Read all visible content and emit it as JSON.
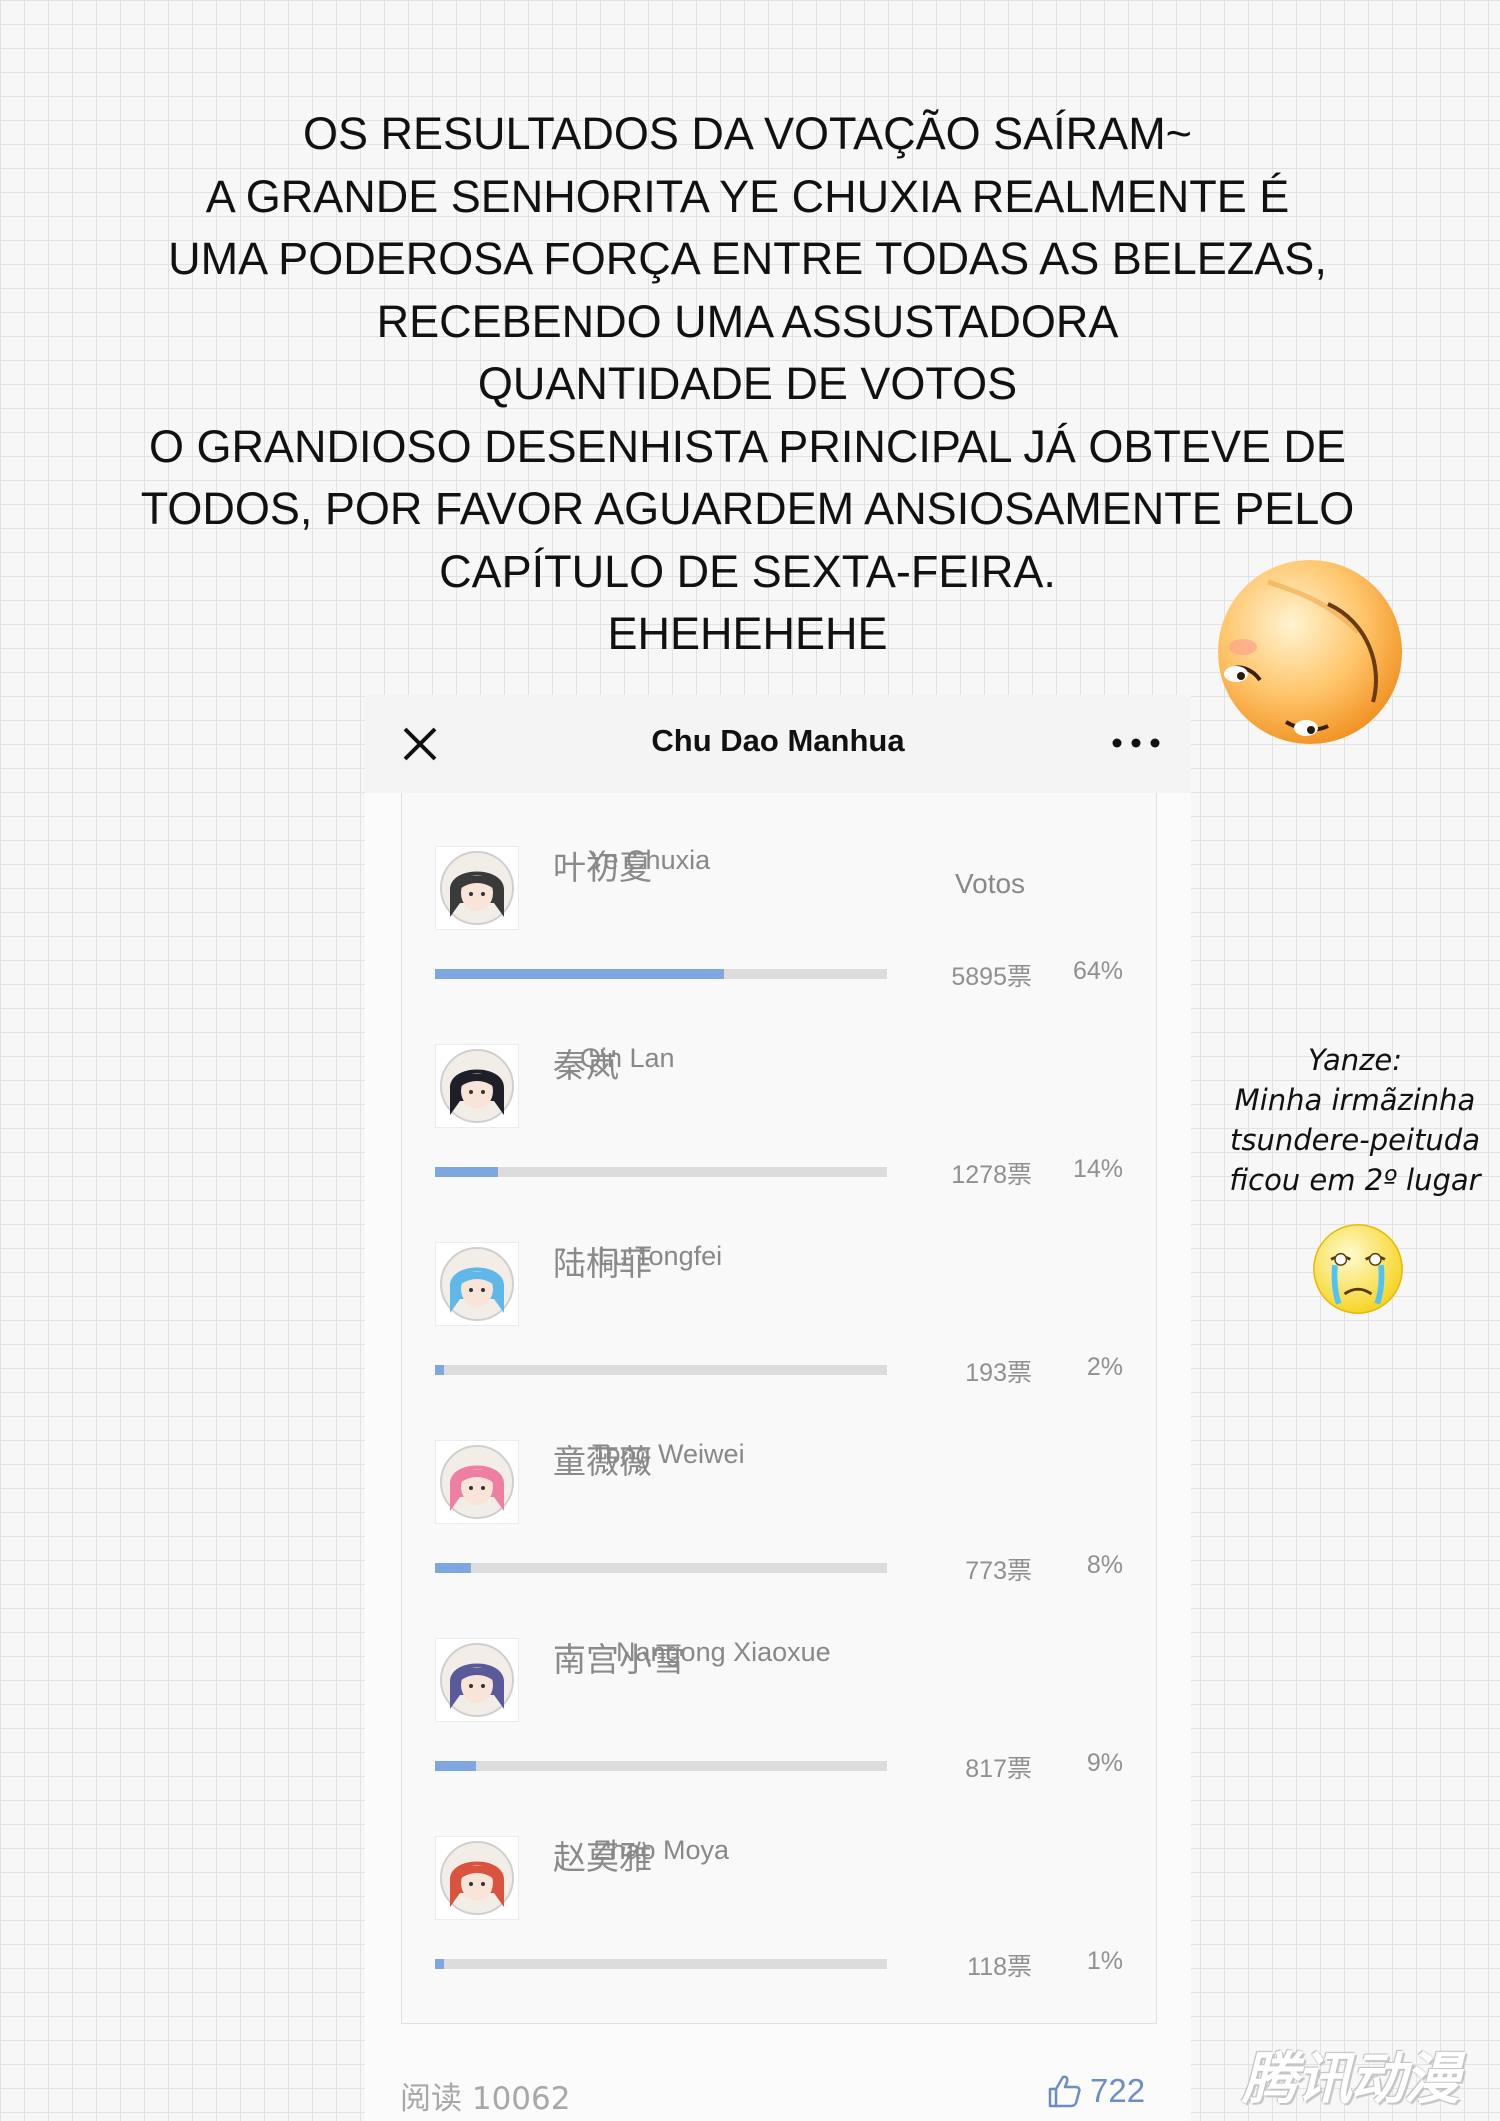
{
  "announcement": {
    "lines": [
      "OS RESULTADOS DA VOTAÇÃO SAÍRAM~",
      "A GRANDE SENHORITA YE CHUXIA REALMENTE É",
      "UMA PODEROSA FORÇA ENTRE TODAS AS BELEZAS,",
      "RECEBENDO UMA ASSUSTADORA",
      "QUANTIDADE DE VOTOS",
      "O GRANDIOSO DESENHISTA PRINCIPAL JÁ OBTEVE DE",
      "TODOS, POR FAVOR AGUARDEM ANSIOSAMENTE PELO",
      "CAPÍTULO DE SEXTA-FEIRA.",
      "EHEHEHEHE"
    ]
  },
  "side_note": {
    "lines": [
      "Yanze:",
      "Minha irmãzinha",
      "tsundere-peituda",
      "ficou em 2º lugar"
    ]
  },
  "header": {
    "title": "Chu Dao Manhua",
    "close_icon": "close-icon",
    "more_icon": "more-dots-icon"
  },
  "poll": {
    "votes_column_label": "Votos",
    "options": [
      {
        "name_cn": "叶初夏",
        "name_en": "Ye Chuxia",
        "votes": "5895票",
        "percent": "64%",
        "fraction": 0.64,
        "hair": "#3a3a3a"
      },
      {
        "name_cn": "秦岚",
        "name_en": "Qin Lan",
        "votes": "1278票",
        "percent": "14%",
        "fraction": 0.14,
        "hair": "#1f1f2a"
      },
      {
        "name_cn": "陆桐菲",
        "name_en": "Lu Tongfei",
        "votes": "193票",
        "percent": "2%",
        "fraction": 0.02,
        "hair": "#5fb8e8"
      },
      {
        "name_cn": "童薇薇",
        "name_en": "Tong Weiwei",
        "votes": "773票",
        "percent": "8%",
        "fraction": 0.08,
        "hair": "#ee7fa3"
      },
      {
        "name_cn": "南宫小雪",
        "name_en": "Nangong Xiaoxue",
        "votes": "817票",
        "percent": "9%",
        "fraction": 0.09,
        "hair": "#5a5a9a"
      },
      {
        "name_cn": "赵莫雅",
        "name_en": "Zhao Moya",
        "votes": "118票",
        "percent": "1%",
        "fraction": 0.01,
        "hair": "#d9533e"
      }
    ]
  },
  "footer": {
    "reads": "阅读 10062",
    "likes": "722",
    "like_icon": "thumbs-up-icon"
  },
  "watermark": "腾讯动漫",
  "colors": {
    "bar_fill": "#7fa7df",
    "bar_track": "#dcdcdc",
    "like_accent": "#6b8fc4"
  }
}
